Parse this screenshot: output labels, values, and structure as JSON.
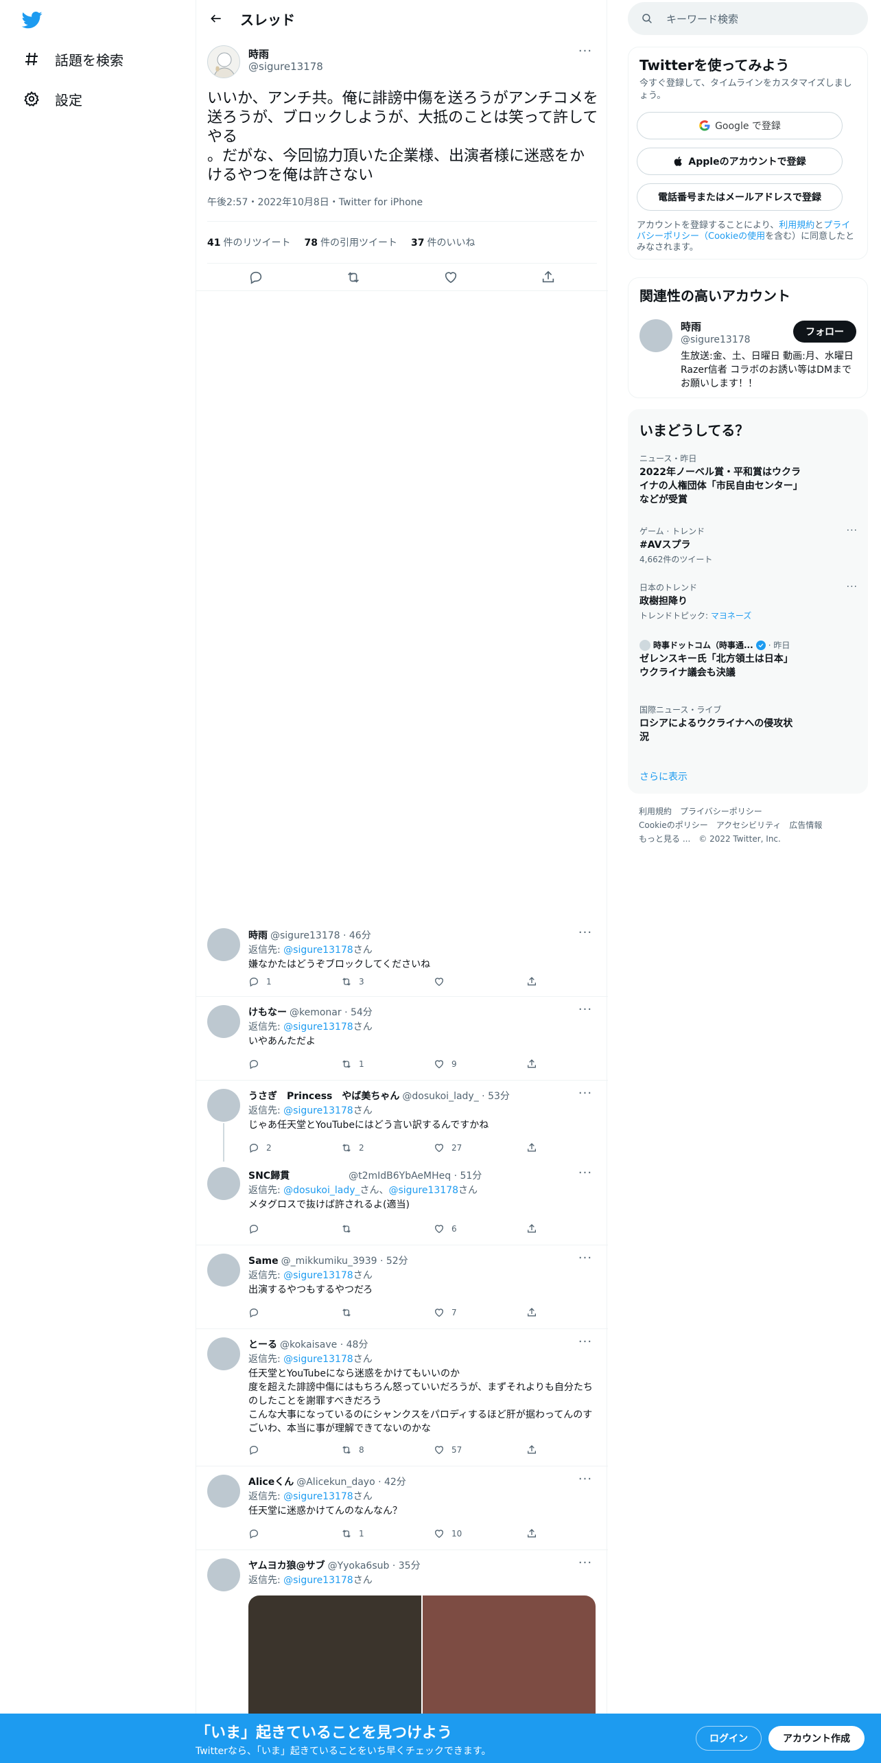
{
  "nav": {
    "explore_label": "話題を検索",
    "settings_label": "設定"
  },
  "header": {
    "title": "スレッド"
  },
  "main_tweet": {
    "name": "時雨",
    "handle": "@sigure13178",
    "text": "いいか、アンチ共。俺に誹謗中傷を送ろうがアンチコメを送ろうが、ブロックしようが、大抵のことは笑って許してやる\n。だがな、今回協力頂いた企業様、出演者様に迷惑をかけるやつを俺は許さない",
    "meta": "午後2:57・2022年10月8日・Twitter for iPhone",
    "retweets": "41",
    "retweets_label": "件のリツイート",
    "quotes": "78",
    "quotes_label": "件の引用ツイート",
    "likes": "37",
    "likes_label": "件のいいね"
  },
  "replies": [
    {
      "name": "時雨",
      "handle": "@sigure13178 · 46分",
      "replyto_prefix": "返信先: ",
      "mention": "@sigure13178",
      "replyto_suffix": "さん",
      "text": "嫌なかたはどうぞブロックしてくださいね",
      "reply_count": "1",
      "retweet_count": "3",
      "like_count": ""
    },
    {
      "name": "けもなー",
      "handle": "@kemonar · 54分",
      "replyto_prefix": "返信先: ",
      "mention": "@sigure13178",
      "replyto_suffix": "さん",
      "text": "いやあんただよ",
      "reply_count": "",
      "retweet_count": "1",
      "like_count": "9"
    },
    {
      "name": "うさぎ　Princess　やば美ちゃん",
      "handle": "@dosukoi_lady_ · 53分",
      "replyto_prefix": "返信先: ",
      "mention": "@sigure13178",
      "replyto_suffix": "さん",
      "text": "じゃあ任天堂とYouTubeにはどう言い訳するんですかね",
      "reply_count": "2",
      "retweet_count": "2",
      "like_count": "27"
    },
    {
      "name": "SNC歸貫",
      "handle": "@t2mIdB6YbAeMHeq · 51分",
      "replyto_prefix": "返信先: ",
      "mention": "@dosukoi_lady_",
      "replyto_mid": "さん、",
      "mention2": "@sigure13178",
      "replyto_suffix": "さん",
      "text": "メタグロスで抜けば許されるよ(適当)",
      "reply_count": "",
      "retweet_count": "",
      "like_count": "6"
    },
    {
      "name": "Same",
      "handle": "@_mikkumiku_3939 · 52分",
      "replyto_prefix": "返信先: ",
      "mention": "@sigure13178",
      "replyto_suffix": "さん",
      "text": "出演するやつもするやつだろ",
      "reply_count": "",
      "retweet_count": "",
      "like_count": "7"
    },
    {
      "name": "とーる",
      "handle": "@kokaisave · 48分",
      "replyto_prefix": "返信先: ",
      "mention": "@sigure13178",
      "replyto_suffix": "さん",
      "text": "任天堂とYouTubeになら迷惑をかけてもいいのか\n度を超えた誹謗中傷にはもちろん怒っていいだろうが、まずそれよりも自分たちのしたことを謝罪すべきだろう\nこんな大事になっているのにシャンクスをパロディするほど肝が据わってんのすごいわ、本当に事が理解できてないのかな",
      "reply_count": "",
      "retweet_count": "8",
      "like_count": "57"
    },
    {
      "name": "Aliceくん",
      "handle": "@Alicekun_dayo · 42分",
      "replyto_prefix": "返信先: ",
      "mention": "@sigure13178",
      "replyto_suffix": "さん",
      "text": "任天堂に迷惑かけてんのなんなん？",
      "reply_count": "",
      "retweet_count": "1",
      "like_count": "10"
    },
    {
      "name": "ヤムヨカ狼@サブ",
      "handle": "@Yyoka6sub · 35分",
      "replyto_prefix": "返信先: ",
      "mention": "@sigure13178",
      "replyto_suffix": "さん",
      "text": "",
      "reply_count": "",
      "retweet_count": "",
      "like_count": ""
    }
  ],
  "search": {
    "placeholder": "キーワード検索"
  },
  "signup": {
    "title": "Twitterを使ってみよう",
    "subtitle": "今すぐ登録して、タイムラインをカスタマイズしましょう。",
    "google_label": "Google で登録",
    "apple_label": "Appleのアカウントで登録",
    "phone_label": "電話番号またはメールアドレスで登録",
    "legal_1": "アカウントを登録することにより、",
    "legal_terms": "利用規約",
    "legal_2": "と",
    "legal_privacy": "プライバシーポリシー",
    "legal_3": "（",
    "legal_cookie": "Cookieの使用",
    "legal_4": "を含む）に同意したとみなされます。"
  },
  "related": {
    "title": "関連性の高いアカウント",
    "name": "時雨",
    "handle": "@sigure13178",
    "follow_label": "フォロー",
    "bio": "生放送:金、土、日曜日 動画:月、水曜日 Razer信者 コラボのお誘い等はDMまでお願いします！！"
  },
  "trends": {
    "title": "いまどうしてる？",
    "items": [
      {
        "meta": "ニュース・昨日",
        "title": "2022年ノーベル賞・平和賞はウクライナの人権団体「市民自由センター」などが受賞"
      },
      {
        "meta": "ゲーム · トレンド",
        "title": "#AVスプラ",
        "sub": "4,662件のツイート"
      },
      {
        "meta": "日本のトレンド",
        "title": "政樹担降り",
        "sub_prefix": "トレンドトピック: ",
        "sub_link": "マヨネーズ"
      },
      {
        "source": "時事ドットコム（時事通...",
        "time": "· 昨日",
        "title": "ゼレンスキー氏「北方領土は日本」　ウクライナ議会も決議"
      },
      {
        "meta": "国際ニュース・ライブ",
        "title": "ロシアによるウクライナへの侵攻状況"
      }
    ],
    "show_more": "さらに表示"
  },
  "footer": {
    "links": [
      "利用規約",
      "プライバシーポリシー",
      "Cookieのポリシー",
      "アクセシビリティ",
      "広告情報",
      "もっと見る ...",
      "© 2022 Twitter, Inc."
    ]
  },
  "banner": {
    "title": "「いま」起きていることを見つけよう",
    "subtitle": "Twitterなら、「いま」起きていることをいち早くチェックできます。",
    "login": "ログイン",
    "signup": "アカウント作成"
  },
  "colors": {
    "accent": "#1d9bf0",
    "text": "#0f1419",
    "secondary": "#536471"
  }
}
